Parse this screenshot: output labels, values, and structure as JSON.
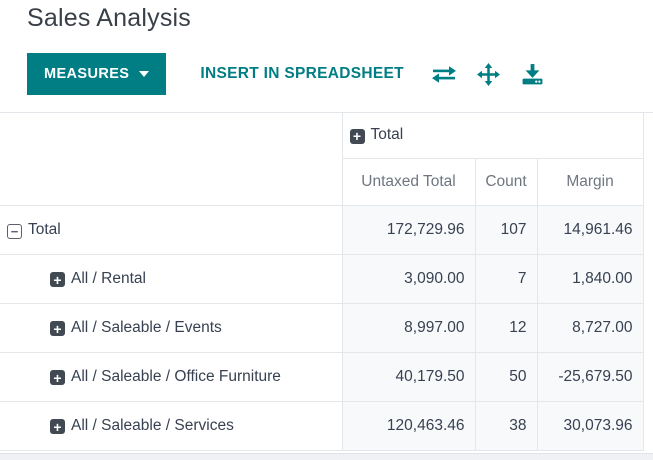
{
  "page_title": "Sales Analysis",
  "toolbar": {
    "measures_label": "MEASURES",
    "insert_label": "INSERT IN SPREADSHEET"
  },
  "colors": {
    "accent_teal": "#017e84",
    "value_cell_bg": "#f8f9fb",
    "muted_header_text": "#6f7680",
    "dark_text": "#374151"
  },
  "pivot": {
    "col_group_header": "Total",
    "measure_headers": [
      "Untaxed Total",
      "Count",
      "Margin"
    ],
    "rows": [
      {
        "label": "Total",
        "state": "expanded",
        "depth": 0,
        "values": [
          "172,729.96",
          "107",
          "14,961.46"
        ]
      },
      {
        "label": "All / Rental",
        "state": "collapsed",
        "depth": 1,
        "values": [
          "3,090.00",
          "7",
          "1,840.00"
        ]
      },
      {
        "label": "All / Saleable / Events",
        "state": "collapsed",
        "depth": 1,
        "values": [
          "8,997.00",
          "12",
          "8,727.00"
        ]
      },
      {
        "label": "All / Saleable / Office Furniture",
        "state": "collapsed",
        "depth": 1,
        "values": [
          "40,179.50",
          "50",
          "-25,679.50"
        ]
      },
      {
        "label": "All / Saleable / Services",
        "state": "collapsed",
        "depth": 1,
        "values": [
          "120,463.46",
          "38",
          "30,073.96"
        ]
      }
    ]
  }
}
